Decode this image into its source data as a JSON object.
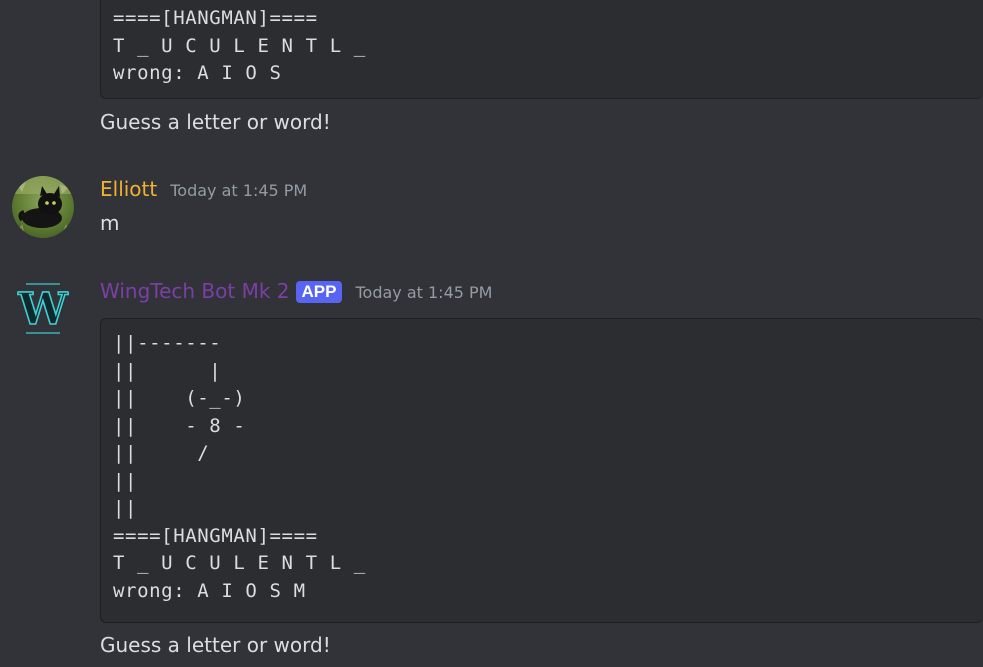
{
  "colors": {
    "background": "#313338",
    "codeblock": "#2b2d31",
    "text": "#dbdee1",
    "timestamp": "#949ba4",
    "elliott_name": "#f0b232",
    "bot_name": "#7b3fa6",
    "app_badge": "#5865f2"
  },
  "messages": [
    {
      "code": "====[HANGMAN]====\nT _ U C U L E N T L _\nwrong: A I O S",
      "text": "Guess a letter or word!"
    },
    {
      "author": "Elliott",
      "timestamp": "Today at 1:45 PM",
      "text": "m",
      "avatar_icon": "black-cat-avatar"
    },
    {
      "author": "WingTech Bot Mk 2",
      "badge": "APP",
      "timestamp": "Today at 1:45 PM",
      "code": "||-------\n||      |\n||    (-_-)\n||    - 8 -\n||     /\n||\n||\n====[HANGMAN]====\nT _ U C U L E N T L _\nwrong: A I O S M",
      "text": "Guess a letter or word!",
      "avatar_icon": "wingtech-logo-avatar"
    }
  ]
}
